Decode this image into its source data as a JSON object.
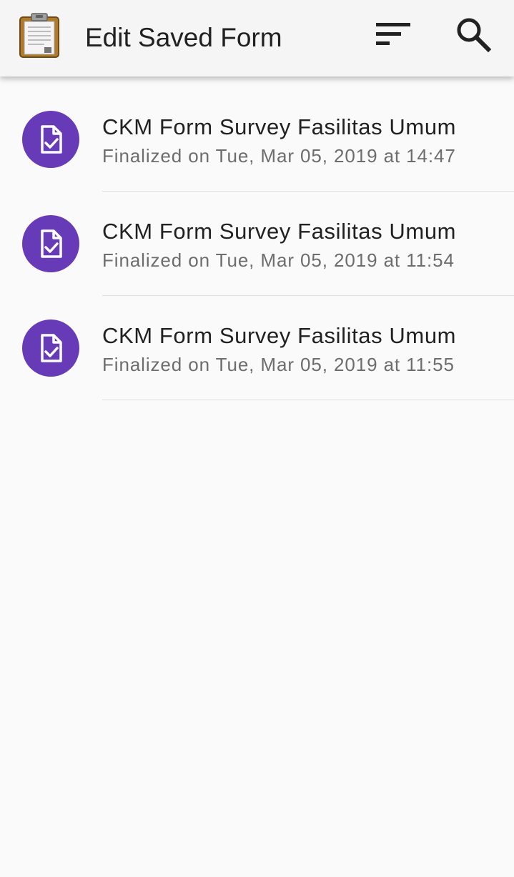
{
  "toolbar": {
    "title": "Edit Saved Form",
    "logo_icon": "clipboard-icon",
    "sort_icon": "sort-icon",
    "search_icon": "search-icon"
  },
  "colors": {
    "toolbar_bg": "#f5f5f5",
    "background": "#fafafa",
    "avatar": "#673ab7",
    "primary_text": "#212121",
    "secondary_text": "#6d6d6d",
    "divider": "#dedede"
  },
  "forms": [
    {
      "name": "CKM Form Survey Fasilitas Umum",
      "status": "Finalized on Tue, Mar 05, 2019 at 14:47",
      "icon": "form-finalized-icon"
    },
    {
      "name": "CKM Form Survey Fasilitas Umum",
      "status": "Finalized on Tue, Mar 05, 2019 at 11:54",
      "icon": "form-finalized-icon"
    },
    {
      "name": "CKM Form Survey Fasilitas Umum",
      "status": "Finalized on Tue, Mar 05, 2019 at 11:55",
      "icon": "form-finalized-icon"
    }
  ]
}
